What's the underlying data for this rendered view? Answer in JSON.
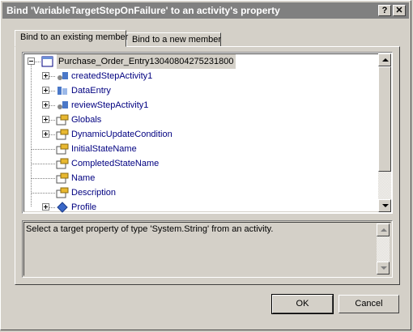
{
  "window": {
    "title": "Bind 'VariableTargetStepOnFailure' to an activity's property",
    "help_label": "?",
    "close_label": "✕"
  },
  "tabs": [
    {
      "label": "Bind to an existing member",
      "active": true
    },
    {
      "label": "Bind to a new member",
      "active": false
    }
  ],
  "tree": {
    "root": {
      "label": "Purchase_Order_Entry13040804275231800",
      "icon": "activity-root-icon"
    },
    "items": [
      {
        "label": "createdStepActivity1",
        "expander": "plus",
        "icon": "activity-icon"
      },
      {
        "label": "DataEntry",
        "expander": "plus",
        "icon": "data-activity-icon"
      },
      {
        "label": "reviewStepActivity1",
        "expander": "plus",
        "icon": "activity-icon"
      },
      {
        "label": "Globals",
        "expander": "plus",
        "icon": "property-icon"
      },
      {
        "label": "DynamicUpdateCondition",
        "expander": "plus",
        "icon": "property-icon"
      },
      {
        "label": "InitialStateName",
        "expander": "none",
        "icon": "property-icon"
      },
      {
        "label": "CompletedStateName",
        "expander": "none",
        "icon": "property-icon"
      },
      {
        "label": "Name",
        "expander": "none",
        "icon": "property-icon"
      },
      {
        "label": "Description",
        "expander": "none",
        "icon": "property-icon"
      },
      {
        "label": "Profile",
        "expander": "plus",
        "icon": "profile-icon"
      }
    ]
  },
  "description": "Select a target property of type 'System.String' from an activity.",
  "buttons": {
    "ok": "OK",
    "cancel": "Cancel"
  },
  "colors": {
    "title_bar": "#808080",
    "face": "#d4d0c8",
    "tree_text": "#000080"
  }
}
